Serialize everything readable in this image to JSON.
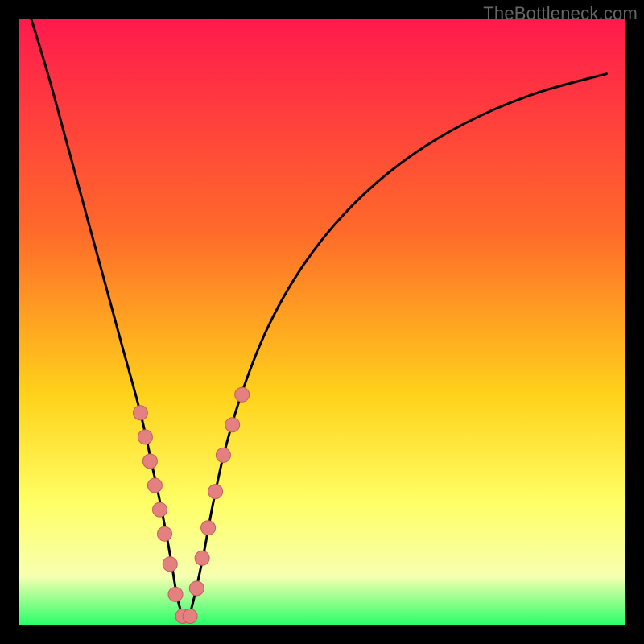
{
  "watermark": "TheBottleneck.com",
  "colors": {
    "bg_black": "#000000",
    "grad_top": "#ff1a4d",
    "grad_mid1": "#ff6a2a",
    "grad_mid2": "#ffd21a",
    "grad_mid3": "#ffff66",
    "grad_low": "#f7ffb0",
    "grad_bottom": "#2bff6a",
    "curve": "#000000",
    "dot_fill": "#e48080",
    "dot_stroke": "#c15e5e"
  },
  "chart_data": {
    "type": "line",
    "title": "",
    "xlabel": "",
    "ylabel": "",
    "xlim": [
      0,
      100
    ],
    "ylim": [
      0,
      100
    ],
    "notch_x": 27,
    "series": [
      {
        "name": "bottleneck-curve",
        "x": [
          2,
          5,
          8,
          11,
          14,
          17,
          20,
          22,
          23.5,
          25,
          26,
          27,
          28,
          29,
          30.5,
          32,
          34,
          37,
          41,
          46,
          52,
          59,
          67,
          76,
          86,
          97
        ],
        "y": [
          100,
          90,
          79,
          68,
          57,
          46,
          35,
          26,
          19,
          11,
          5,
          1.5,
          1.5,
          5,
          12,
          20,
          29,
          39,
          49,
          58,
          66,
          73,
          79,
          84,
          88,
          91
        ]
      }
    ],
    "scatter": [
      {
        "name": "left-branch-dots",
        "x": [
          20.0,
          20.8,
          21.6,
          22.4,
          23.2,
          24.0,
          24.9,
          25.8,
          27.0,
          28.2
        ],
        "y": [
          35,
          31,
          27,
          23,
          19,
          15,
          10,
          5,
          1.4,
          1.4
        ]
      },
      {
        "name": "right-branch-dots",
        "x": [
          29.3,
          30.2,
          31.2,
          32.4,
          33.7,
          35.2,
          36.8
        ],
        "y": [
          6,
          11,
          16,
          22,
          28,
          33,
          38
        ]
      }
    ],
    "gradient_stops": [
      {
        "pct": 0,
        "key": "grad_top"
      },
      {
        "pct": 35,
        "key": "grad_mid1"
      },
      {
        "pct": 62,
        "key": "grad_mid2"
      },
      {
        "pct": 80,
        "key": "grad_mid3"
      },
      {
        "pct": 92,
        "key": "grad_low"
      },
      {
        "pct": 100,
        "key": "grad_bottom"
      }
    ]
  }
}
